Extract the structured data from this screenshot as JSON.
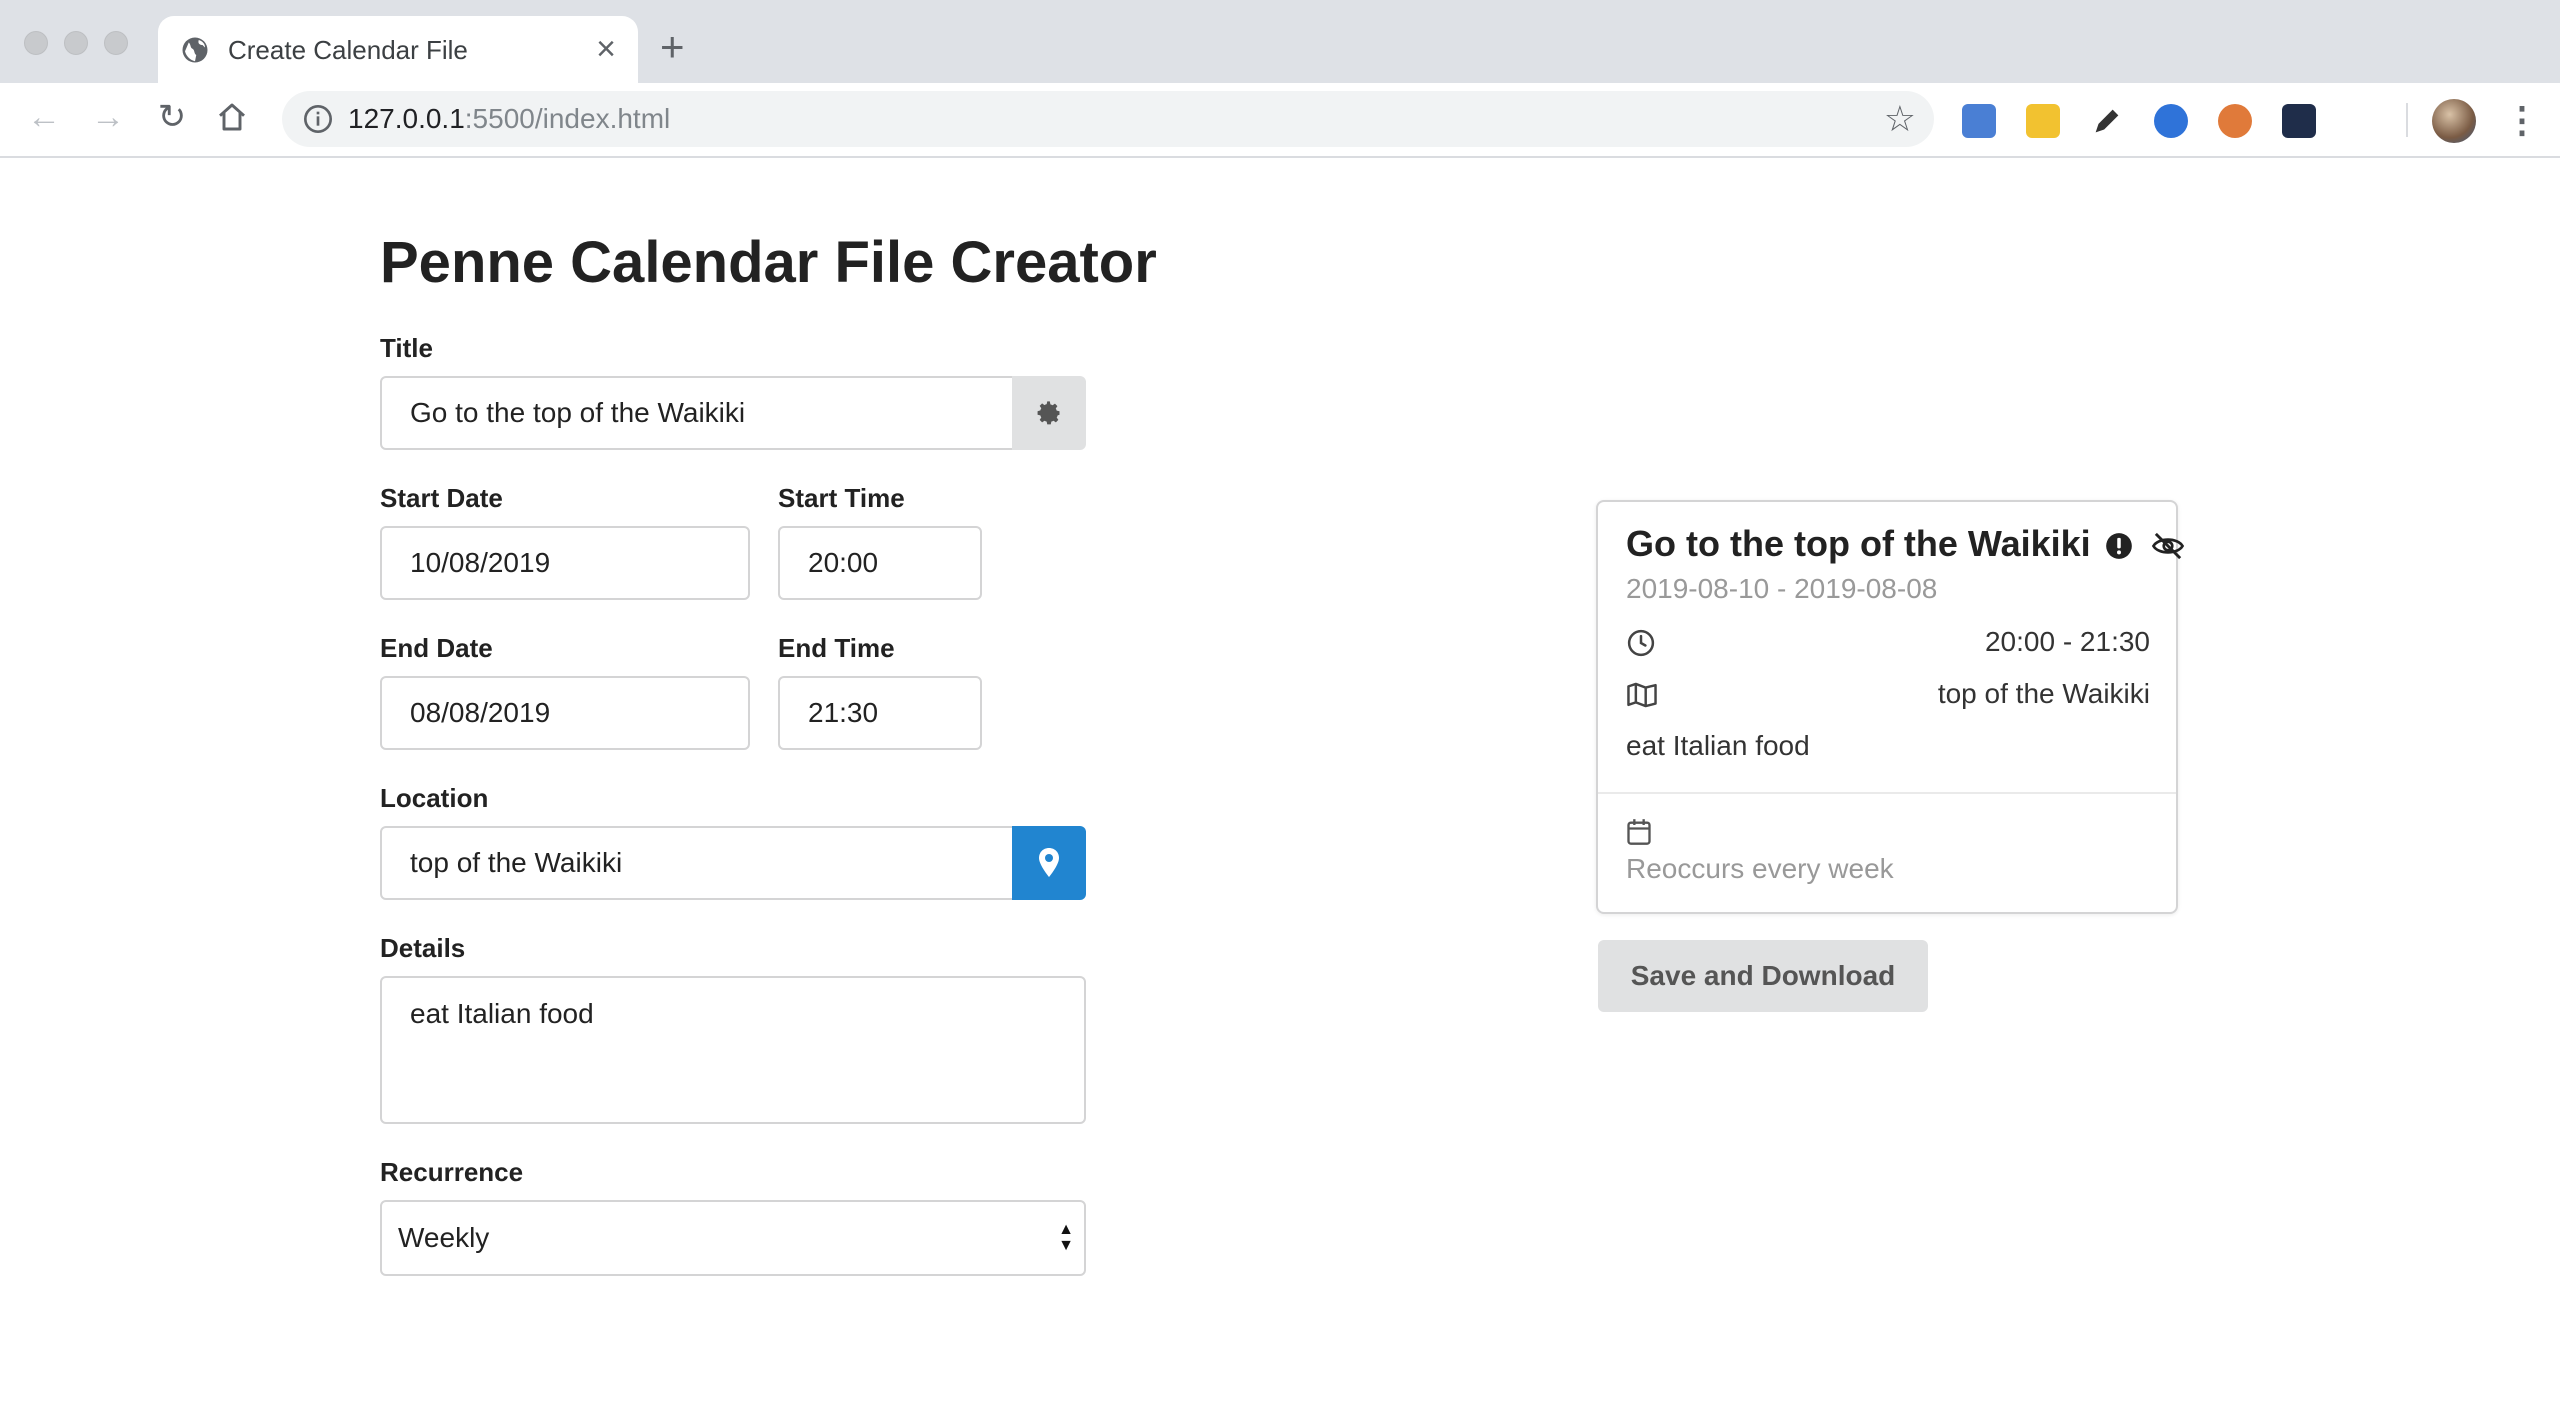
{
  "browser": {
    "tab_title": "Create Calendar File",
    "url_host": "127.0.0.1",
    "url_rest": ":5500/index.html"
  },
  "page": {
    "heading": "Penne Calendar File Creator"
  },
  "form": {
    "title_label": "Title",
    "title_value": "Go to the top of the Waikiki",
    "start_date_label": "Start Date",
    "start_date_value": "10/08/2019",
    "start_time_label": "Start Time",
    "start_time_value": "20:00",
    "end_date_label": "End Date",
    "end_date_value": "08/08/2019",
    "end_time_label": "End Time",
    "end_time_value": "21:30",
    "location_label": "Location",
    "location_value": "top of the Waikiki",
    "details_label": "Details",
    "details_value": "eat Italian food",
    "recurrence_label": "Recurrence",
    "recurrence_value": "Weekly"
  },
  "preview": {
    "title": "Go to the top of the Waikiki",
    "dates": "2019-08-10 - 2019-08-08",
    "time_range": "20:00 - 21:30",
    "location": "top of the Waikiki",
    "details": "eat Italian food",
    "recurrence": "Reoccurs every week"
  },
  "actions": {
    "save_label": "Save and Download"
  },
  "colors": {
    "location_button": "#2185d0",
    "settings_button": "#e0e1e2",
    "save_button": "#e0e1e2"
  },
  "icons": [
    "globe-icon",
    "close-icon",
    "plus-icon",
    "back-icon",
    "forward-icon",
    "reload-icon",
    "home-icon",
    "info-icon",
    "star-icon",
    "gear-icon",
    "map-marker-icon",
    "exclamation-circle-icon",
    "eye-slash-icon",
    "clock-icon",
    "map-icon",
    "calendar-icon"
  ]
}
